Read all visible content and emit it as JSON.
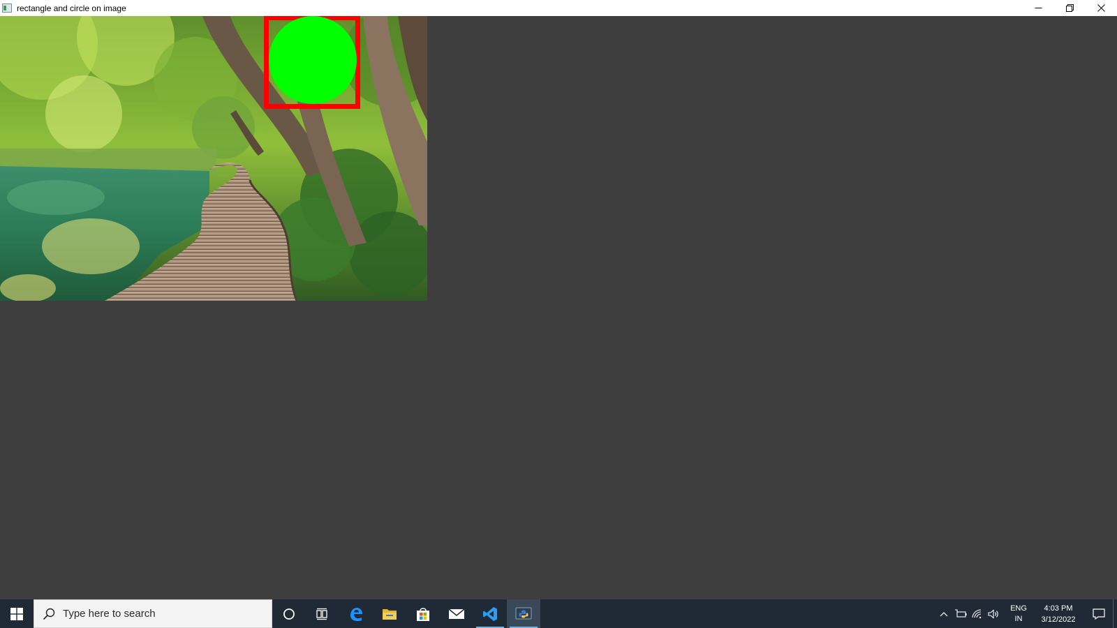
{
  "window": {
    "title": "rectangle and circle on image",
    "controls": {
      "minimize_icon": "minimize-icon",
      "restore_icon": "restore-icon",
      "close_icon": "close-icon"
    }
  },
  "image": {
    "scene": "forest-boardwalk-lake",
    "overlay": {
      "rectangle_color": "#ff0000",
      "circle_color": "#00ff00"
    }
  },
  "taskbar": {
    "search": {
      "placeholder": "Type here to search"
    },
    "pinned": [
      {
        "name": "cortana-icon"
      },
      {
        "name": "task-view-icon"
      },
      {
        "name": "edge-icon"
      },
      {
        "name": "file-explorer-icon"
      },
      {
        "name": "store-icon"
      },
      {
        "name": "mail-icon"
      },
      {
        "name": "vscode-icon"
      },
      {
        "name": "python-icon"
      }
    ],
    "tray": {
      "language_line1": "ENG",
      "language_line2": "IN",
      "time": "4:03 PM",
      "date": "3/12/2022"
    }
  }
}
